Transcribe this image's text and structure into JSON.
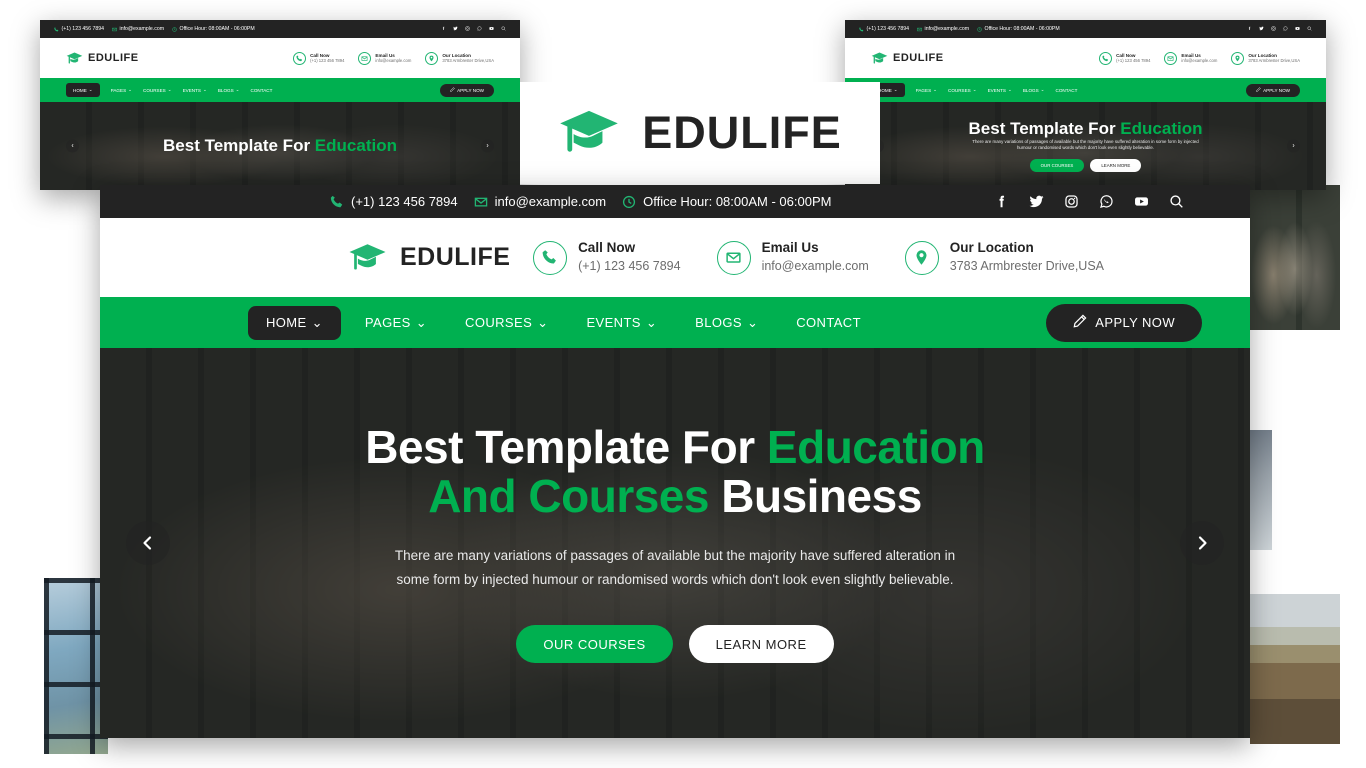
{
  "site": {
    "brand_name": "EDULIFE",
    "logo_icon": "graduation-cap-icon",
    "accent_color": "#00b050",
    "accent_color_alt": "#22b573",
    "dark_color": "#232323"
  },
  "topbar": {
    "phone": "(+1) 123 456 7894",
    "phone_icon": "phone-icon",
    "email": "info@example.com",
    "email_icon": "envelope-icon",
    "office_hours": "Office Hour: 08:00AM - 06:00PM",
    "clock_icon": "clock-icon",
    "socials": [
      {
        "name": "facebook-icon",
        "glyph": "f"
      },
      {
        "name": "twitter-icon",
        "glyph": "t"
      },
      {
        "name": "instagram-icon",
        "glyph": "i"
      },
      {
        "name": "whatsapp-icon",
        "glyph": "w"
      },
      {
        "name": "youtube-icon",
        "glyph": "y"
      }
    ],
    "search_icon": "search-icon"
  },
  "header_info": [
    {
      "icon": "phone-icon",
      "title": "Call Now",
      "sub": "(+1) 123 456 7894"
    },
    {
      "icon": "envelope-icon",
      "title": "Email Us",
      "sub": "info@example.com"
    },
    {
      "icon": "location-pin-icon",
      "title": "Our Location",
      "sub": "3783 Armbrester Drive,USA"
    }
  ],
  "nav": {
    "items": [
      {
        "label": "HOME",
        "has_dropdown": true,
        "active": true
      },
      {
        "label": "PAGES",
        "has_dropdown": true,
        "active": false
      },
      {
        "label": "COURSES",
        "has_dropdown": true,
        "active": false
      },
      {
        "label": "EVENTS",
        "has_dropdown": true,
        "active": false
      },
      {
        "label": "BLOGS",
        "has_dropdown": true,
        "active": false
      },
      {
        "label": "CONTACT",
        "has_dropdown": false,
        "active": false
      }
    ],
    "caret": "⌄",
    "apply_label": "APPLY NOW",
    "apply_icon": "pencil-icon"
  },
  "hero": {
    "title_line1_a": "Best Template For ",
    "title_line1_b": "Education",
    "title_line2_a": "And Courses ",
    "title_line2_b": "Business",
    "paragraph": "There are many variations of passages of available but the majority have suffered alteration in some form by injected humour or randomised words which don't look even slightly believable.",
    "btn_primary": "OUR COURSES",
    "btn_secondary": "LEARN MORE",
    "arrow_prev_icon": "chevron-left-icon",
    "arrow_next_icon": "chevron-right-icon"
  }
}
